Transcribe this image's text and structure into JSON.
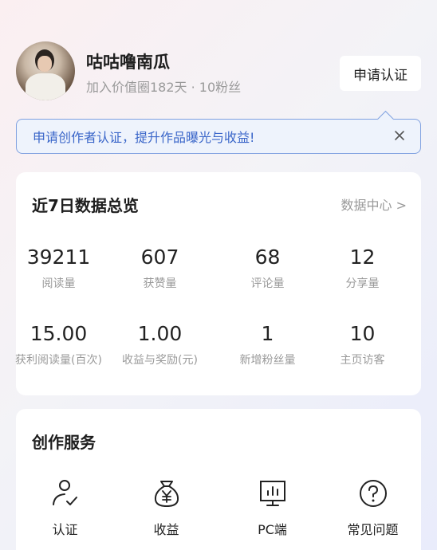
{
  "profile": {
    "username": "咕咕噜南瓜",
    "meta": "加入价值圈182天 · 10粉丝",
    "apply_button": "申请认证"
  },
  "tip": {
    "text": "申请创作者认证，提升作品曝光与收益!",
    "close_icon": "close-icon"
  },
  "overview": {
    "title": "近7日数据总览",
    "link": "数据中心 >",
    "stats": [
      {
        "value": "39211",
        "label": "阅读量"
      },
      {
        "value": "607",
        "label": "获赞量"
      },
      {
        "value": "68",
        "label": "评论量"
      },
      {
        "value": "12",
        "label": "分享量"
      },
      {
        "value": "15.00",
        "label": "获利阅读量(百次)"
      },
      {
        "value": "1.00",
        "label": "收益与奖励(元)"
      },
      {
        "value": "1",
        "label": "新增粉丝量"
      },
      {
        "value": "10",
        "label": "主页访客"
      }
    ]
  },
  "services": {
    "title": "创作服务",
    "items": [
      {
        "label": "认证",
        "icon": "user-check-icon"
      },
      {
        "label": "收益",
        "icon": "money-bag-icon"
      },
      {
        "label": "PC端",
        "icon": "monitor-chart-icon"
      },
      {
        "label": "常见问题",
        "icon": "question-circle-icon"
      }
    ]
  }
}
